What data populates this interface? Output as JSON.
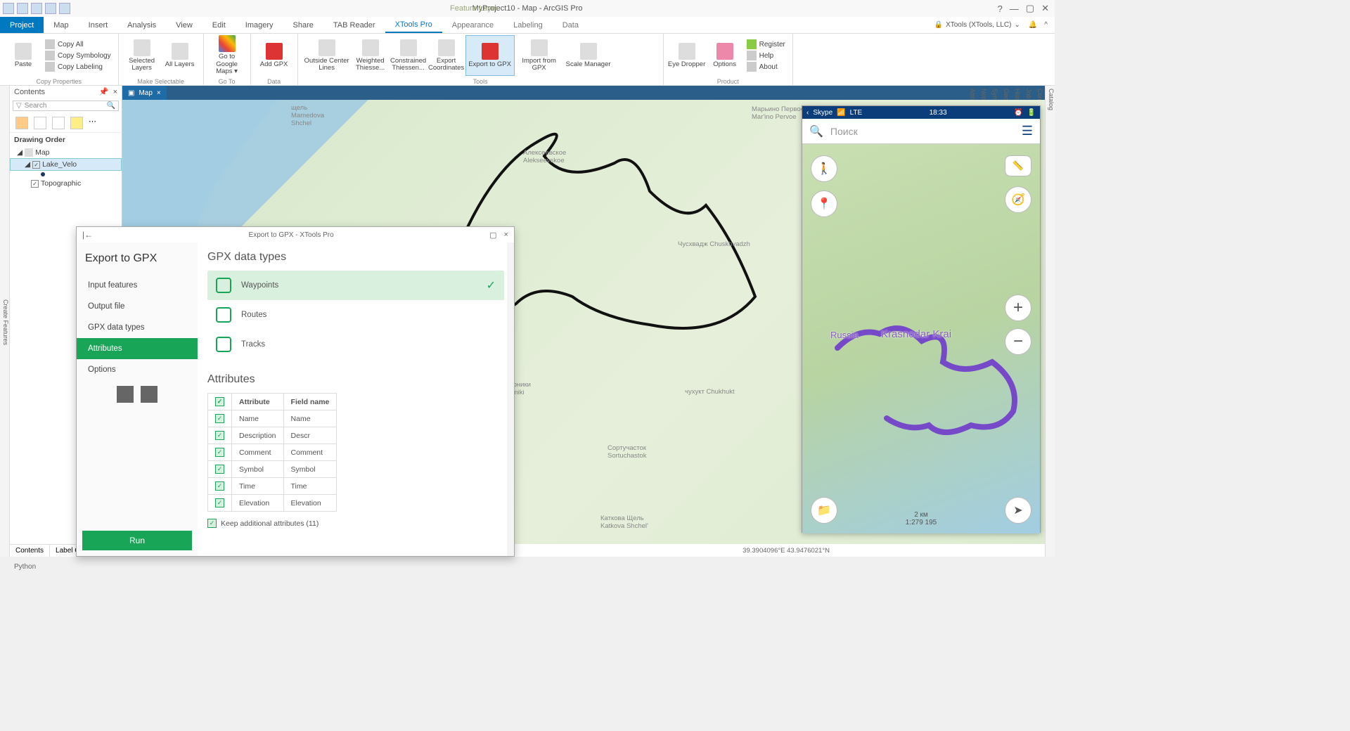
{
  "app": {
    "title": "MyProject10 - Map - ArcGIS Pro",
    "context_tab": "Feature Layer",
    "signin": "XTools (XTools, LLC)"
  },
  "win": {
    "help": "?",
    "min": "—",
    "max": "▢",
    "close": "✕",
    "dropdown": "⌄"
  },
  "tabs": [
    "Project",
    "Map",
    "Insert",
    "Analysis",
    "View",
    "Edit",
    "Imagery",
    "Share",
    "TAB Reader",
    "XTools Pro",
    "Appearance",
    "Labeling",
    "Data"
  ],
  "ribbon": {
    "clipboard": {
      "paste": "Paste",
      "copy_all": "Copy All",
      "copy_symb": "Copy Symbology",
      "copy_label": "Copy Labeling",
      "group": "Copy Properties"
    },
    "selectable": {
      "selected": "Selected\nLayers",
      "all": "All\nLayers",
      "group": "Make Selectable"
    },
    "goto": {
      "gmaps": "Go to Google\nMaps ▾",
      "group": "Go To"
    },
    "data": {
      "gpx": "Add\nGPX",
      "group": "Data"
    },
    "tools": {
      "ocl": "Outside Center\nLines",
      "wt": "Weighted\nThiesse...",
      "ct": "Constrained\nThiessen...",
      "ec": "Export\nCoordinates",
      "exgpx": "Export to GPX",
      "imgpx": "Import from GPX",
      "scale": "Scale Manager",
      "eyed": "Eye\nDropper",
      "options": "Options",
      "group": "Tools"
    },
    "product": {
      "register": "Register",
      "help": "Help",
      "about": "About",
      "group": "Product"
    }
  },
  "contents": {
    "title": "Contents",
    "search_ph": "Search",
    "drawing_order": "Drawing Order",
    "map": "Map",
    "layer1": "Lake_Velo",
    "layer2": "Topographic",
    "tab1": "Contents",
    "tab2": "Label Cl"
  },
  "left_rail": "Create Features",
  "right_rail": [
    "Catalog",
    "Configure Pop-ups",
    "Job Status",
    "History",
    "Geoprocessing",
    "Symbology",
    "Notifications",
    "Attributes"
  ],
  "map": {
    "tab": "Map",
    "close": "×",
    "coords": "39.3904096°E 43.9476021°N",
    "lbl_shchel": "щель\nMamedova\nShchel",
    "lbl_aleks": "Алексеевское\nAlekseevskoe",
    "lbl_marino": "Марьино Первое\nMar'ino Pervoe",
    "lbl_chus": "Чусхвадж Chuskhvadzh",
    "lbl_sortu": "Сортучасток\nSortuchastok",
    "lbl_katkova": "Каткова Щель\nKatkova Shchel'",
    "lbl_loniki": "лоники\nloniki",
    "lbl_chukh": "чухукт Chukhukt"
  },
  "phone": {
    "back": "‹",
    "app": "Skype",
    "signal": "📶",
    "net": "LTE",
    "time": "18:33",
    "search": "Поиск",
    "region1": "Russia",
    "region2": "Krasnodar Krai",
    "scale_dist": "2 км",
    "scale_ratio": "1:279 195",
    "plus": "+",
    "minus": "−",
    "arrow": "➤",
    "ruler": "📏",
    "walk": "🚶",
    "pin": "📍",
    "folder": "📁",
    "compass": "🧭"
  },
  "dialog": {
    "titlebar": "Export to GPX  -  XTools Pro",
    "back": "|←",
    "heading": "Export to GPX",
    "nav": [
      "Input features",
      "Output file",
      "GPX data types",
      "Attributes",
      "Options"
    ],
    "run": "Run",
    "sec1": "GPX data types",
    "waypoints": "Waypoints",
    "routes": "Routes",
    "tracks": "Tracks",
    "check": "✓",
    "sec2": "Attributes",
    "col1": "Attribute",
    "col2": "Field name",
    "rows": [
      {
        "a": "Name",
        "f": "Name"
      },
      {
        "a": "Description",
        "f": "Descr"
      },
      {
        "a": "Comment",
        "f": "Comment"
      },
      {
        "a": "Symbol",
        "f": "Symbol"
      },
      {
        "a": "Time",
        "f": "Time"
      },
      {
        "a": "Elevation",
        "f": "Elevation"
      }
    ],
    "keep": "Keep additional attributes (11)"
  },
  "python": "Python"
}
